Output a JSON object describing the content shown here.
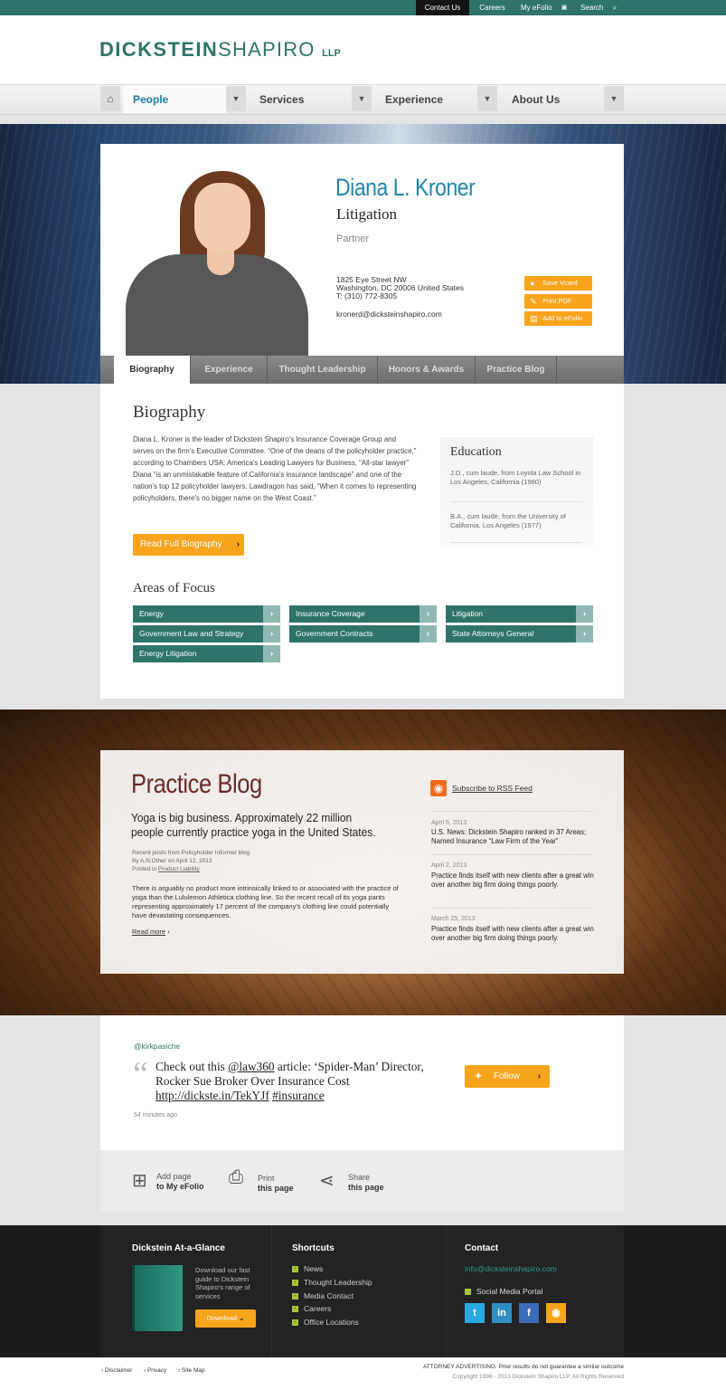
{
  "topbar": {
    "contact": "Contact Us",
    "careers": "Careers",
    "efolio": "My eFolio",
    "search": "Search"
  },
  "header": {
    "logo_bold": "DICKSTEIN",
    "logo_light": "SHAPIRO",
    "logo_suffix": "LLP"
  },
  "nav": {
    "people": "People",
    "services": "Services",
    "experience": "Experience",
    "about": "About Us"
  },
  "profile": {
    "name": "Diana L. Kroner",
    "practice": "Litigation",
    "title": "Partner",
    "address1": "1825 Eye Street NW",
    "address2": "Washington, DC 20006 United States",
    "phone": "T: (310) 772-8305",
    "email": "kronerd@dicksteinshapiro.com",
    "buttons": {
      "vcard": "Save Vcard",
      "pdf": "Print PDF",
      "efolio": "Add to eFolio"
    }
  },
  "tabs": [
    "Biography",
    "Experience",
    "Thought Leadership",
    "Honors & Awards",
    "Practice Blog"
  ],
  "biography": {
    "heading": "Biography",
    "text": "Diana L. Kroner is the leader of Dickstein Shapiro's Insurance Coverage Group and serves on the firm's Executive Committee. “One of the deans of the policyholder practice,” according to Chambers USA: America's Leading Lawyers for Business, “All-star lawyer” Diana “is an unmistakable feature of California's insurance landscape” and one of the nation's top 12 policyholder lawyers. Lawdragon has said, “When it comes to representing policyholders, there's no bigger name on the West Coast.”",
    "read_full": "Read Full Biography"
  },
  "education": {
    "heading": "Education",
    "items": [
      "J.D., cum laude, from Loyola Law School in Los Angeles, California (1980)",
      "B.A., cum laude, from the University of California, Los Angeles (1977)"
    ]
  },
  "areas_of_focus": {
    "heading": "Areas of Focus",
    "items": [
      "Energy",
      "Insurance Coverage",
      "Litigation",
      "Government Law and Strategy",
      "Government Contracts",
      "State Attorneys General",
      "Energy Litigation"
    ]
  },
  "blog": {
    "heading": "Practice Blog",
    "headline": "Yoga is big business. Approximately 22 million people currently practice yoga in the United States.",
    "meta1": "Recent posts from Policyholder Informer blog",
    "meta2": "By A.N.Other on April 12, 2013",
    "meta3_prefix": "Posted in ",
    "meta3_link": "Product Liability",
    "excerpt": "There is arguably no product more intrinsically linked to or associated with the practice of yoga than the Lululemon Athletica clothing line. So the recent recall of its yoga pants representing approximately 17 percent of the company's clothing line could potentially have devastating consequences.",
    "read_more": "Read more",
    "rss": "Subscribe to RSS Feed",
    "posts": [
      {
        "date": "April 6, 2013",
        "text": "U.S. News: Dickstein Shapiro ranked in 37 Areas; Named Insurance “Law Firm of the Year”"
      },
      {
        "date": "April 2, 2013",
        "text": "Practice finds itself with new clients after a great win over another big firm doing things poorly."
      },
      {
        "date": "March 25, 2013",
        "text": "Practice finds itself with new clients after a great win over another big firm doing things poorly."
      }
    ]
  },
  "tweet": {
    "handle": "@kirkpasiche",
    "t1": "Check out this ",
    "mention": "@law360",
    "t2": " article: ‘Spider-Man’ Director, Rocker Sue Broker Over Insurance Cost ",
    "link": "http://dickste.in/TekYJf",
    "hashtag": "#insurance",
    "time": "54 minutes ago",
    "follow": "Follow"
  },
  "actions": {
    "add_l1": "Add page",
    "add_l2": "to My eFolio",
    "print_l1": "Print",
    "print_l2": "this page",
    "share_l1": "Share",
    "share_l2": "this page"
  },
  "footer": {
    "glance_heading": "Dickstein At-a-Glance",
    "glance_text": "Download our fast guide to Dickstein Shapiro's range of services",
    "download": "Download",
    "shortcuts_heading": "Shortcuts",
    "shortcuts": [
      "News",
      "Thought Leadership",
      "Media Contact",
      "Careers",
      "Office Locations"
    ],
    "contact_heading": "Contact",
    "contact_email": "info@dicksteinshapiro.com",
    "social_portal": "Social Media Portal"
  },
  "bottom": {
    "disclaimer": "› Disclaimer",
    "privacy": "› Privacy",
    "sitemap": "› Site Map",
    "legal1": "ATTORNEY ADVERTISING:   Prior results do not guarantee a similar outcome",
    "legal2": "Copyright 1996 - 2013 Dickstein Shapiro LLP.  All Rights Reserved"
  },
  "colors": {
    "brand_green": "#2f7468",
    "accent_orange": "#f8a41c",
    "name_blue": "#1f87aa",
    "blog_maroon": "#6a2a2a"
  }
}
